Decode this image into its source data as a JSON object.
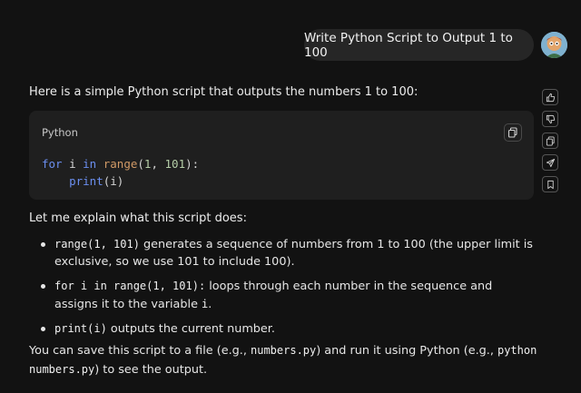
{
  "user_message": {
    "text": "Write Python Script to Output 1 to 100"
  },
  "assistant": {
    "intro": "Here is a simple Python script that outputs the numbers 1 to 100:",
    "code_block": {
      "language": "Python",
      "line1": {
        "kw_for": "for",
        "var": " i ",
        "kw_in": "in",
        "sp": " ",
        "fn": "range",
        "open": "(",
        "a": "1",
        "comma": ", ",
        "b": "101",
        "close": "):"
      },
      "line2": {
        "indent": "    ",
        "fn": "print",
        "args": "(i)"
      }
    },
    "explain_heading": "Let me explain what this script does:",
    "bullets": [
      {
        "code": "range(1, 101)",
        "text": " generates a sequence of numbers from 1 to 100 (the upper limit is exclusive, so we use 101 to include 100)."
      },
      {
        "code": "for i in range(1, 101):",
        "text": " loops through each number in the sequence and assigns it to the variable ",
        "code2": "i",
        "text2": "."
      },
      {
        "code": "print(i)",
        "text": " outputs the current number."
      }
    ],
    "outro": {
      "t1": "You can save this script to a file (e.g., ",
      "c1": "numbers.py",
      "t2": ") and run it using Python (e.g., ",
      "c2": "python numbers.py",
      "t3": ") to see the output."
    }
  },
  "icons": {
    "copy": "copy-icon",
    "actions": [
      "thumbs-up-icon",
      "thumbs-down-icon",
      "copy-icon",
      "share-icon",
      "bookmark-icon"
    ]
  },
  "colors": {
    "background": "#121212",
    "bubble": "#262626",
    "code_bg": "#1f1f1f",
    "keyword": "#6b8ff0",
    "function": "#d19a66"
  }
}
